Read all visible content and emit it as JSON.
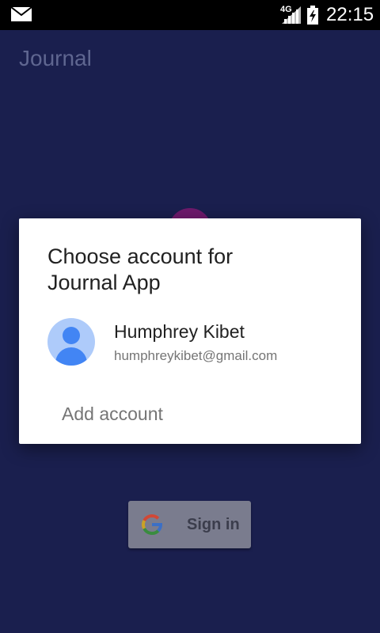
{
  "status_bar": {
    "network": "4G",
    "time": "22:15",
    "icons": [
      "mail-icon",
      "signal-icon",
      "battery-charging-icon"
    ]
  },
  "app": {
    "title": "Journal"
  },
  "dialog": {
    "title": "Choose account for Journal App",
    "account": {
      "name": "Humphrey Kibet",
      "email": "humphreykibet@gmail.com",
      "avatar_icon": "person-avatar-icon"
    },
    "add_account_label": "Add account"
  },
  "signin": {
    "label": "Sign in",
    "icon": "google-g-icon"
  },
  "colors": {
    "background": "#1a1f4e",
    "dialog": "#ffffff",
    "avatar_bg": "#aecbfa",
    "avatar_fg": "#4285f4"
  }
}
